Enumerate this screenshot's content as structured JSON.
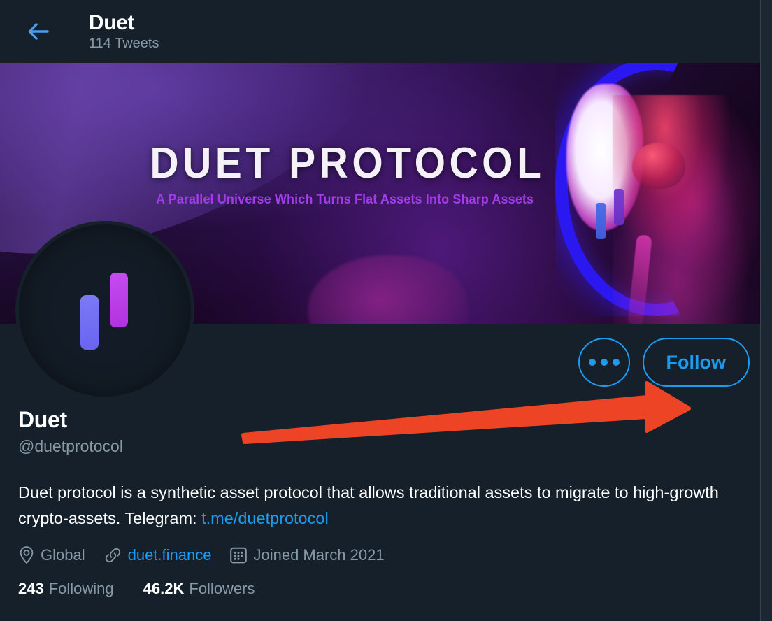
{
  "header": {
    "back_icon": "arrow-left-icon",
    "title": "Duet",
    "tweet_count": "114 Tweets"
  },
  "banner": {
    "title": "DUET PROTOCOL",
    "tagline": "A Parallel Universe Which Turns Flat Assets Into Sharp Assets",
    "art_description": "crescent-moon-astronaut"
  },
  "avatar": {
    "alt": "Duet logo"
  },
  "actions": {
    "more_label": "More",
    "more_icon": "ellipsis-icon",
    "follow_label": "Follow"
  },
  "annotation": {
    "type": "arrow",
    "points_to": "follow-button",
    "color": "#ec4424"
  },
  "profile": {
    "display_name": "Duet",
    "handle": "@duetprotocol",
    "bio_part1": "Duet protocol is a synthetic asset protocol that allows traditional assets to migrate to high-growth crypto-assets. Telegram: ",
    "bio_link": "t.me/duetprotocol",
    "location_icon": "location-pin-icon",
    "location": "Global",
    "link_icon": "link-icon",
    "website": "duet.finance",
    "calendar_icon": "calendar-icon",
    "joined": "Joined March 2021",
    "following_count": "243",
    "following_label": "Following",
    "followers_count": "46.2K",
    "followers_label": "Followers"
  },
  "colors": {
    "background": "#15202b",
    "accent_blue": "#1d9bf0",
    "muted_text": "#8899a6",
    "arrow_red": "#ec4424",
    "logo_blue": "#7b7bf7",
    "logo_magenta": "#c64cf0",
    "banner_purple": "#a13ce8"
  }
}
